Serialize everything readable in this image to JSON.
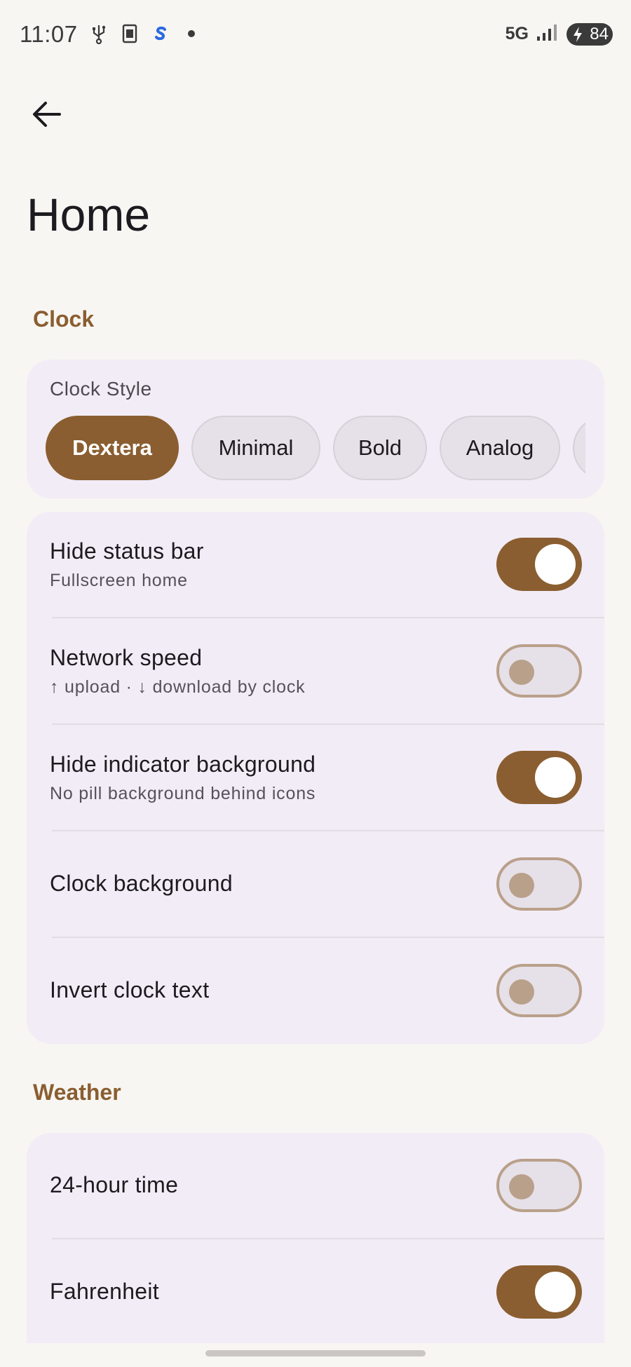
{
  "status_bar": {
    "time": "11:07",
    "network": "5G",
    "battery": "84",
    "icons": [
      "usb-icon",
      "sim-card-icon",
      "shazam-app-icon",
      "notification-dot-icon",
      "signal-icon",
      "battery-charging-icon"
    ]
  },
  "page": {
    "title": "Home"
  },
  "sections": {
    "clock": {
      "label": "Clock",
      "clock_style": {
        "label": "Clock Style",
        "options": [
          "Dextera",
          "Minimal",
          "Bold",
          "Analog"
        ],
        "selected": "Dextera"
      },
      "settings": [
        {
          "title": "Hide status bar",
          "subtitle": "Fullscreen home",
          "enabled": true
        },
        {
          "title": "Network speed",
          "subtitle": "↑ upload · ↓ download by clock",
          "enabled": false
        },
        {
          "title": "Hide indicator background",
          "subtitle": "No pill background behind icons",
          "enabled": true
        },
        {
          "title": "Clock background",
          "subtitle": "",
          "enabled": false
        },
        {
          "title": "Invert clock text",
          "subtitle": "",
          "enabled": false
        }
      ]
    },
    "weather": {
      "label": "Weather",
      "settings": [
        {
          "title": "24-hour time",
          "subtitle": "",
          "enabled": false
        },
        {
          "title": "Fahrenheit",
          "subtitle": "",
          "enabled": true
        }
      ]
    }
  },
  "colors": {
    "accent": "#8a5e30",
    "background": "#f8f6f3",
    "card": "#f2ecf6",
    "switch_off_outline": "#b9a08a"
  }
}
